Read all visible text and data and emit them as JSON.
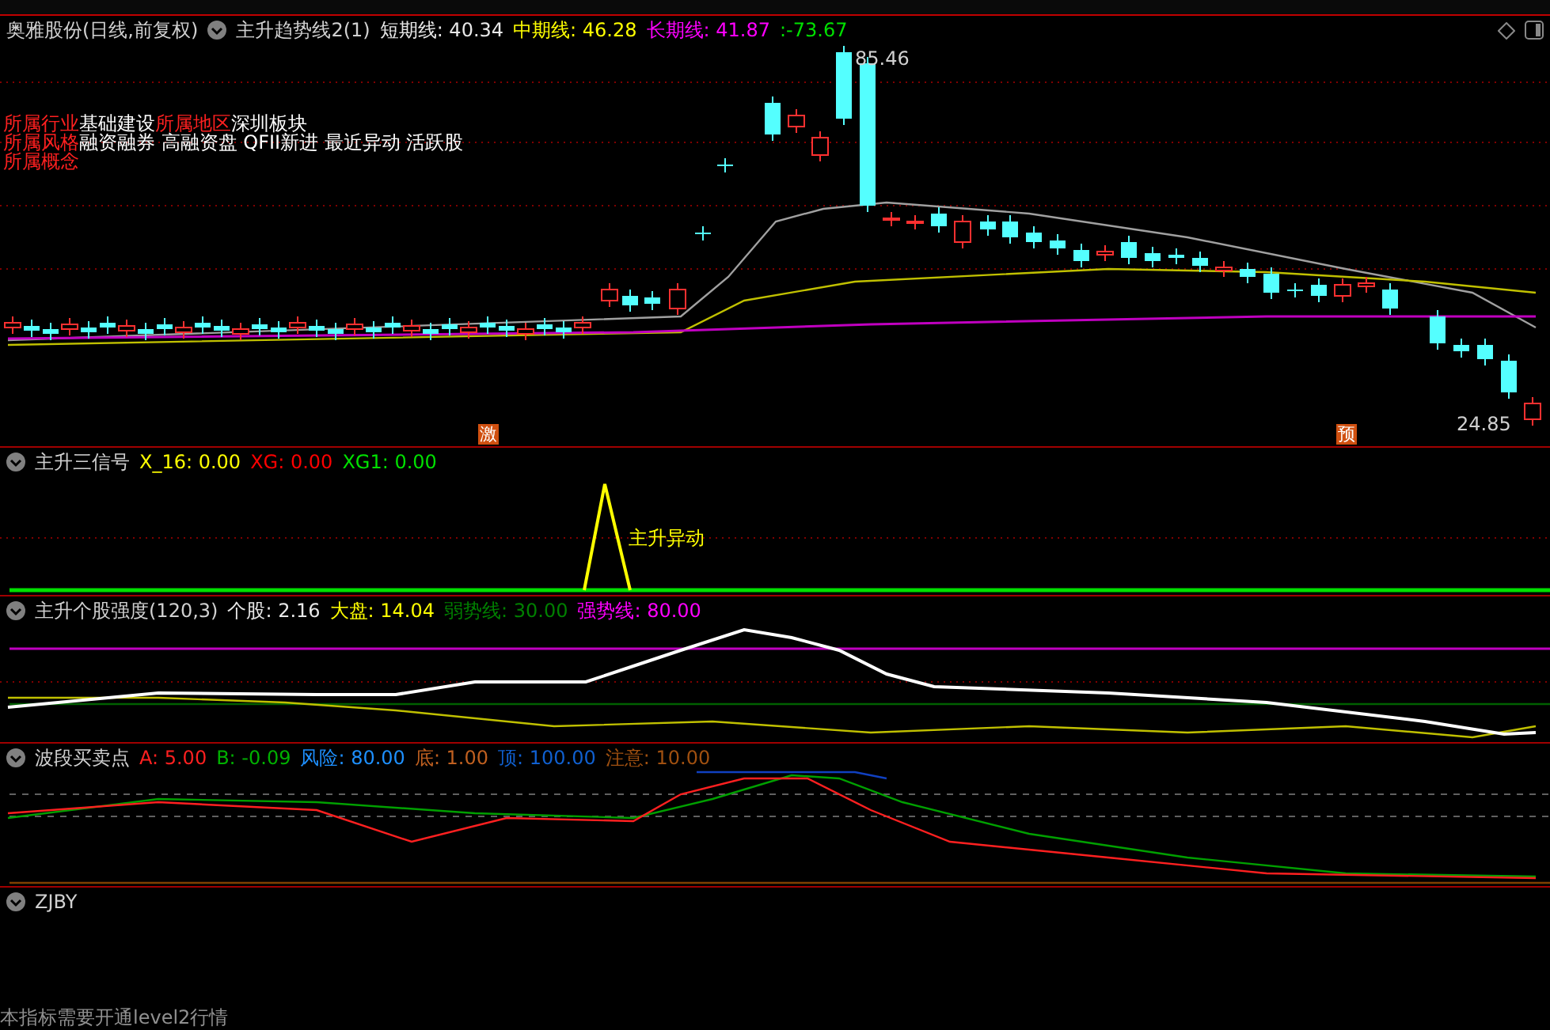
{
  "main_panel": {
    "stock": "奥雅股份(日线,前复权)",
    "indicator": "主升趋势线2(1)",
    "values": [
      {
        "text": "短期线: 40.34",
        "color": "#e8e8e8"
      },
      {
        "text": "中期线: 46.28",
        "color": "#ffff00"
      },
      {
        "text": "长期线: 41.87",
        "color": "#ff00ff"
      },
      {
        "text": ":-73.67",
        "color": "#00e000"
      }
    ],
    "info_rows": [
      [
        {
          "kind": "label",
          "text": "所属行业"
        },
        {
          "kind": "value",
          "text": "基础建设"
        },
        {
          "kind": "label",
          "text": "所属地区"
        },
        {
          "kind": "value",
          "text": "深圳板块"
        }
      ],
      [
        {
          "kind": "label",
          "text": "所属风格"
        },
        {
          "kind": "value",
          "text": "融资融券 高融资盘 QFII新进 最近异动 活跃股"
        }
      ],
      [
        {
          "kind": "label",
          "text": "所属概念"
        }
      ]
    ],
    "high_label": "85.46",
    "low_label": "24.85",
    "markers": [
      "激",
      "预"
    ]
  },
  "signal_panel": {
    "indicator": "主升三信号",
    "values": [
      {
        "text": "X_16: 0.00",
        "color": "#ffff00"
      },
      {
        "text": "XG: 0.00",
        "color": "#ff0000"
      },
      {
        "text": "XG1: 0.00",
        "color": "#00e000"
      }
    ],
    "annotation": "主升异动"
  },
  "strength_panel": {
    "indicator": "主升个股强度(120,3)",
    "values": [
      {
        "text": "个股: 2.16",
        "color": "#e8e8e8"
      },
      {
        "text": "大盘: 14.04",
        "color": "#ffff00"
      },
      {
        "text": "弱势线: 30.00",
        "color": "#008000"
      },
      {
        "text": "强势线: 80.00",
        "color": "#ff00ff"
      }
    ]
  },
  "wave_panel": {
    "indicator": "波段买卖点",
    "values": [
      {
        "text": "A: 5.00",
        "color": "#ff2020"
      },
      {
        "text": "B: -0.09",
        "color": "#00b000"
      },
      {
        "text": "风险: 80.00",
        "color": "#1e90ff"
      },
      {
        "text": "底: 1.00",
        "color": "#c06020"
      },
      {
        "text": "顶: 100.00",
        "color": "#1060d0"
      },
      {
        "text": "注意: 10.00",
        "color": "#a05010"
      }
    ]
  },
  "zjby_panel": {
    "indicator": "ZJBY",
    "note": "本指标需要开通level2行情"
  }
}
